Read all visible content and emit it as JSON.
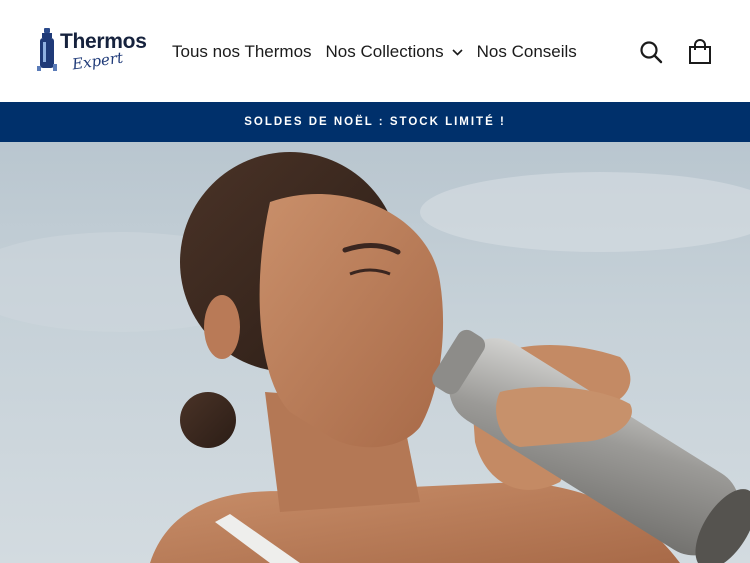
{
  "brand": {
    "logo_word": "Thermos",
    "logo_script": "Expert"
  },
  "nav": {
    "items": [
      {
        "label": "Tous nos Thermos"
      },
      {
        "label": "Nos Collections"
      },
      {
        "label": "Nos Conseils"
      }
    ]
  },
  "icons": {
    "search": "search-icon",
    "cart": "shopping-bag-icon",
    "dropdown": "chevron-down-icon"
  },
  "announcement": {
    "text": "SOLDES DE NOËL : STOCK LIMITÉ !"
  },
  "colors": {
    "announcement_bg": "#00306b",
    "announcement_text": "#ffffff",
    "brand_navy": "#16223d"
  }
}
